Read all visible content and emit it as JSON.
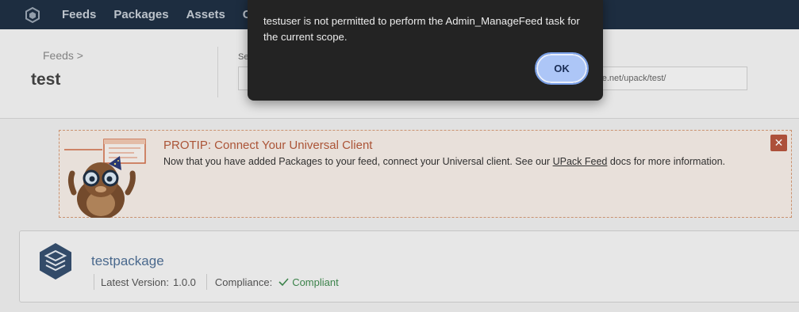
{
  "nav": {
    "items": [
      {
        "label": "Feeds"
      },
      {
        "label": "Packages"
      },
      {
        "label": "Assets"
      },
      {
        "label": "C"
      }
    ]
  },
  "header": {
    "breadcrumb": "Feeds >",
    "title": "test",
    "search_label": "Se",
    "url": "dyne.net/upack/test/"
  },
  "protip": {
    "title": "PROTIP: Connect Your Universal Client",
    "body_prefix": "Now that you have added Packages to your feed, connect your Universal client. See our ",
    "link_text": "UPack Feed",
    "body_suffix": " docs for more information.",
    "close": "✕"
  },
  "package": {
    "name": "testpackage",
    "latest_version_label": "Latest Version:",
    "latest_version": "1.0.0",
    "compliance_label": "Compliance:",
    "compliance_status": "Compliant",
    "compliance_icon": "checkmark-icon"
  },
  "dialog": {
    "message": "testuser is not permitted to perform the Admin_ManageFeed task for the current scope.",
    "ok_label": "OK"
  },
  "colors": {
    "nav_bg": "#1f3044",
    "protip_title": "#b5593a",
    "compliant": "#3f8a4e",
    "dialog_bg": "#232323",
    "ok_button": "#adc6f7"
  }
}
